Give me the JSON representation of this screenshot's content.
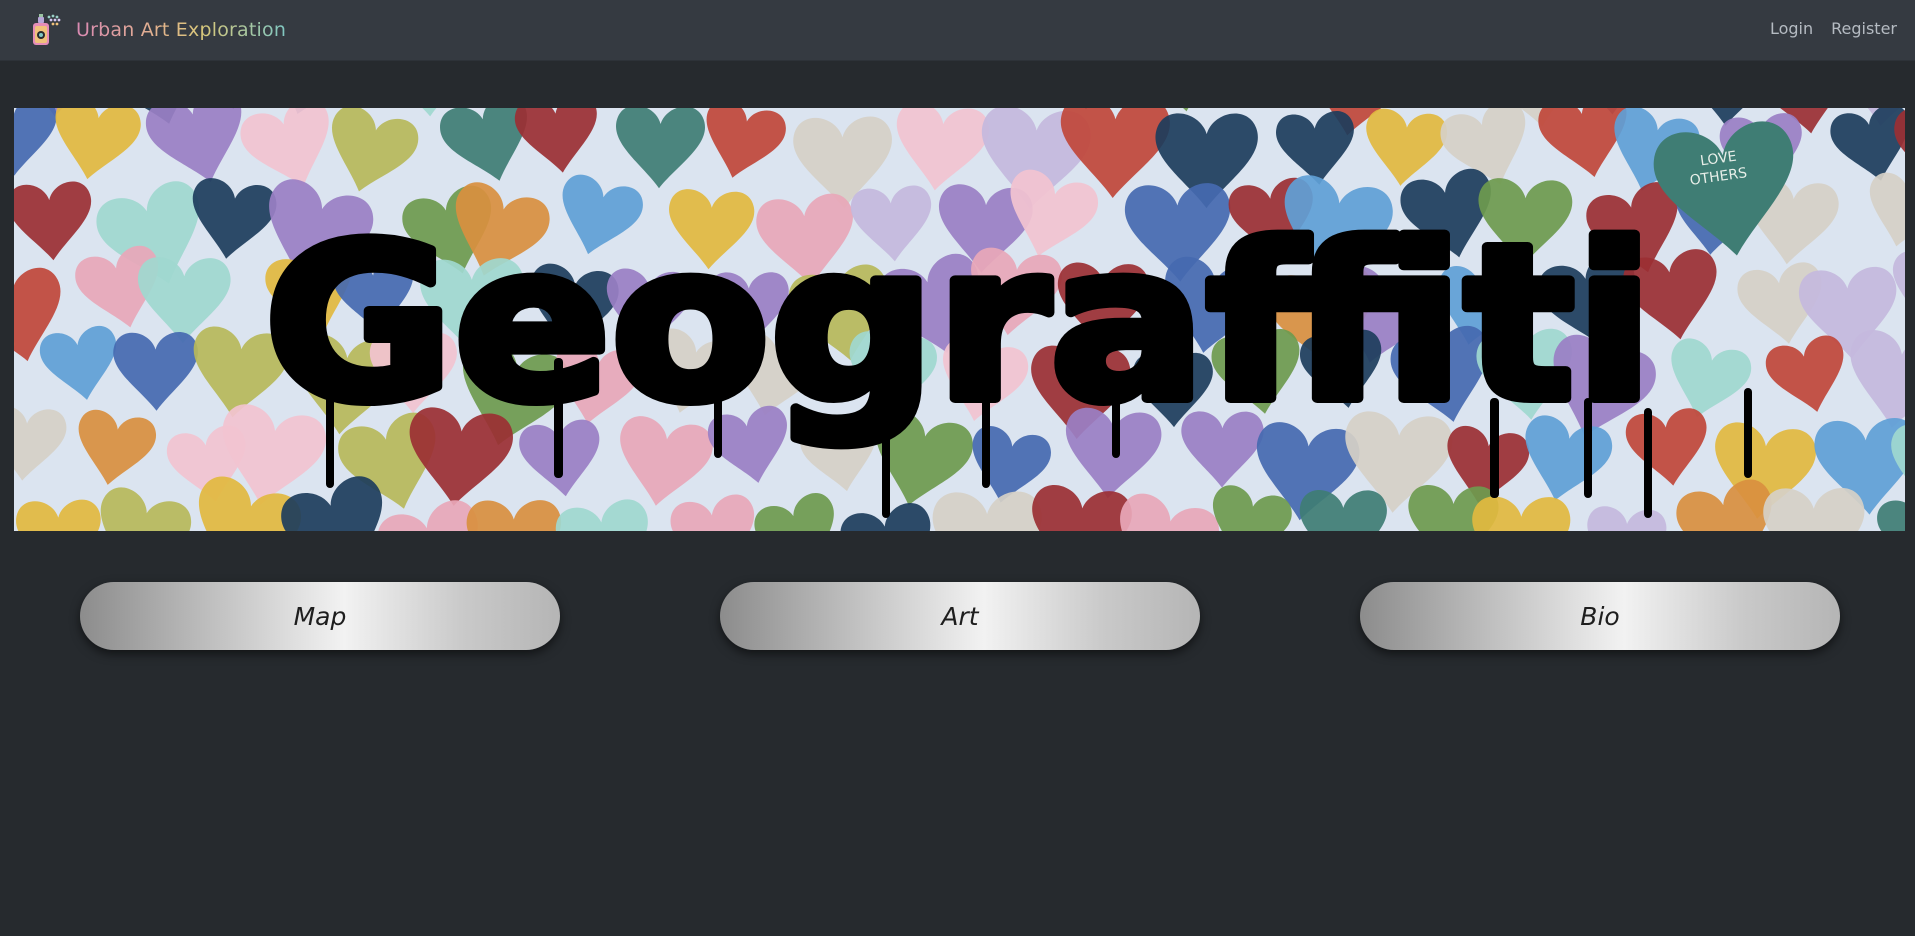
{
  "navbar": {
    "brand_icon": "spray-can-icon",
    "brand_text": "Urban Art Exploration",
    "links": [
      {
        "label": "Login"
      },
      {
        "label": "Register"
      }
    ]
  },
  "hero": {
    "title": "Geograffiti",
    "heart_text_line1": "LOVE",
    "heart_text_line2": "OTHERS"
  },
  "buttons": [
    {
      "label": "Map"
    },
    {
      "label": "Art"
    },
    {
      "label": "Bio"
    }
  ],
  "colors": {
    "page_background": "#262a2e",
    "navbar_background": "#353a41",
    "nav_link": "#b5bbc2",
    "brand_gradient": [
      "#d98ab3",
      "#e3b48c",
      "#d8c77a",
      "#7fc7c2"
    ]
  }
}
